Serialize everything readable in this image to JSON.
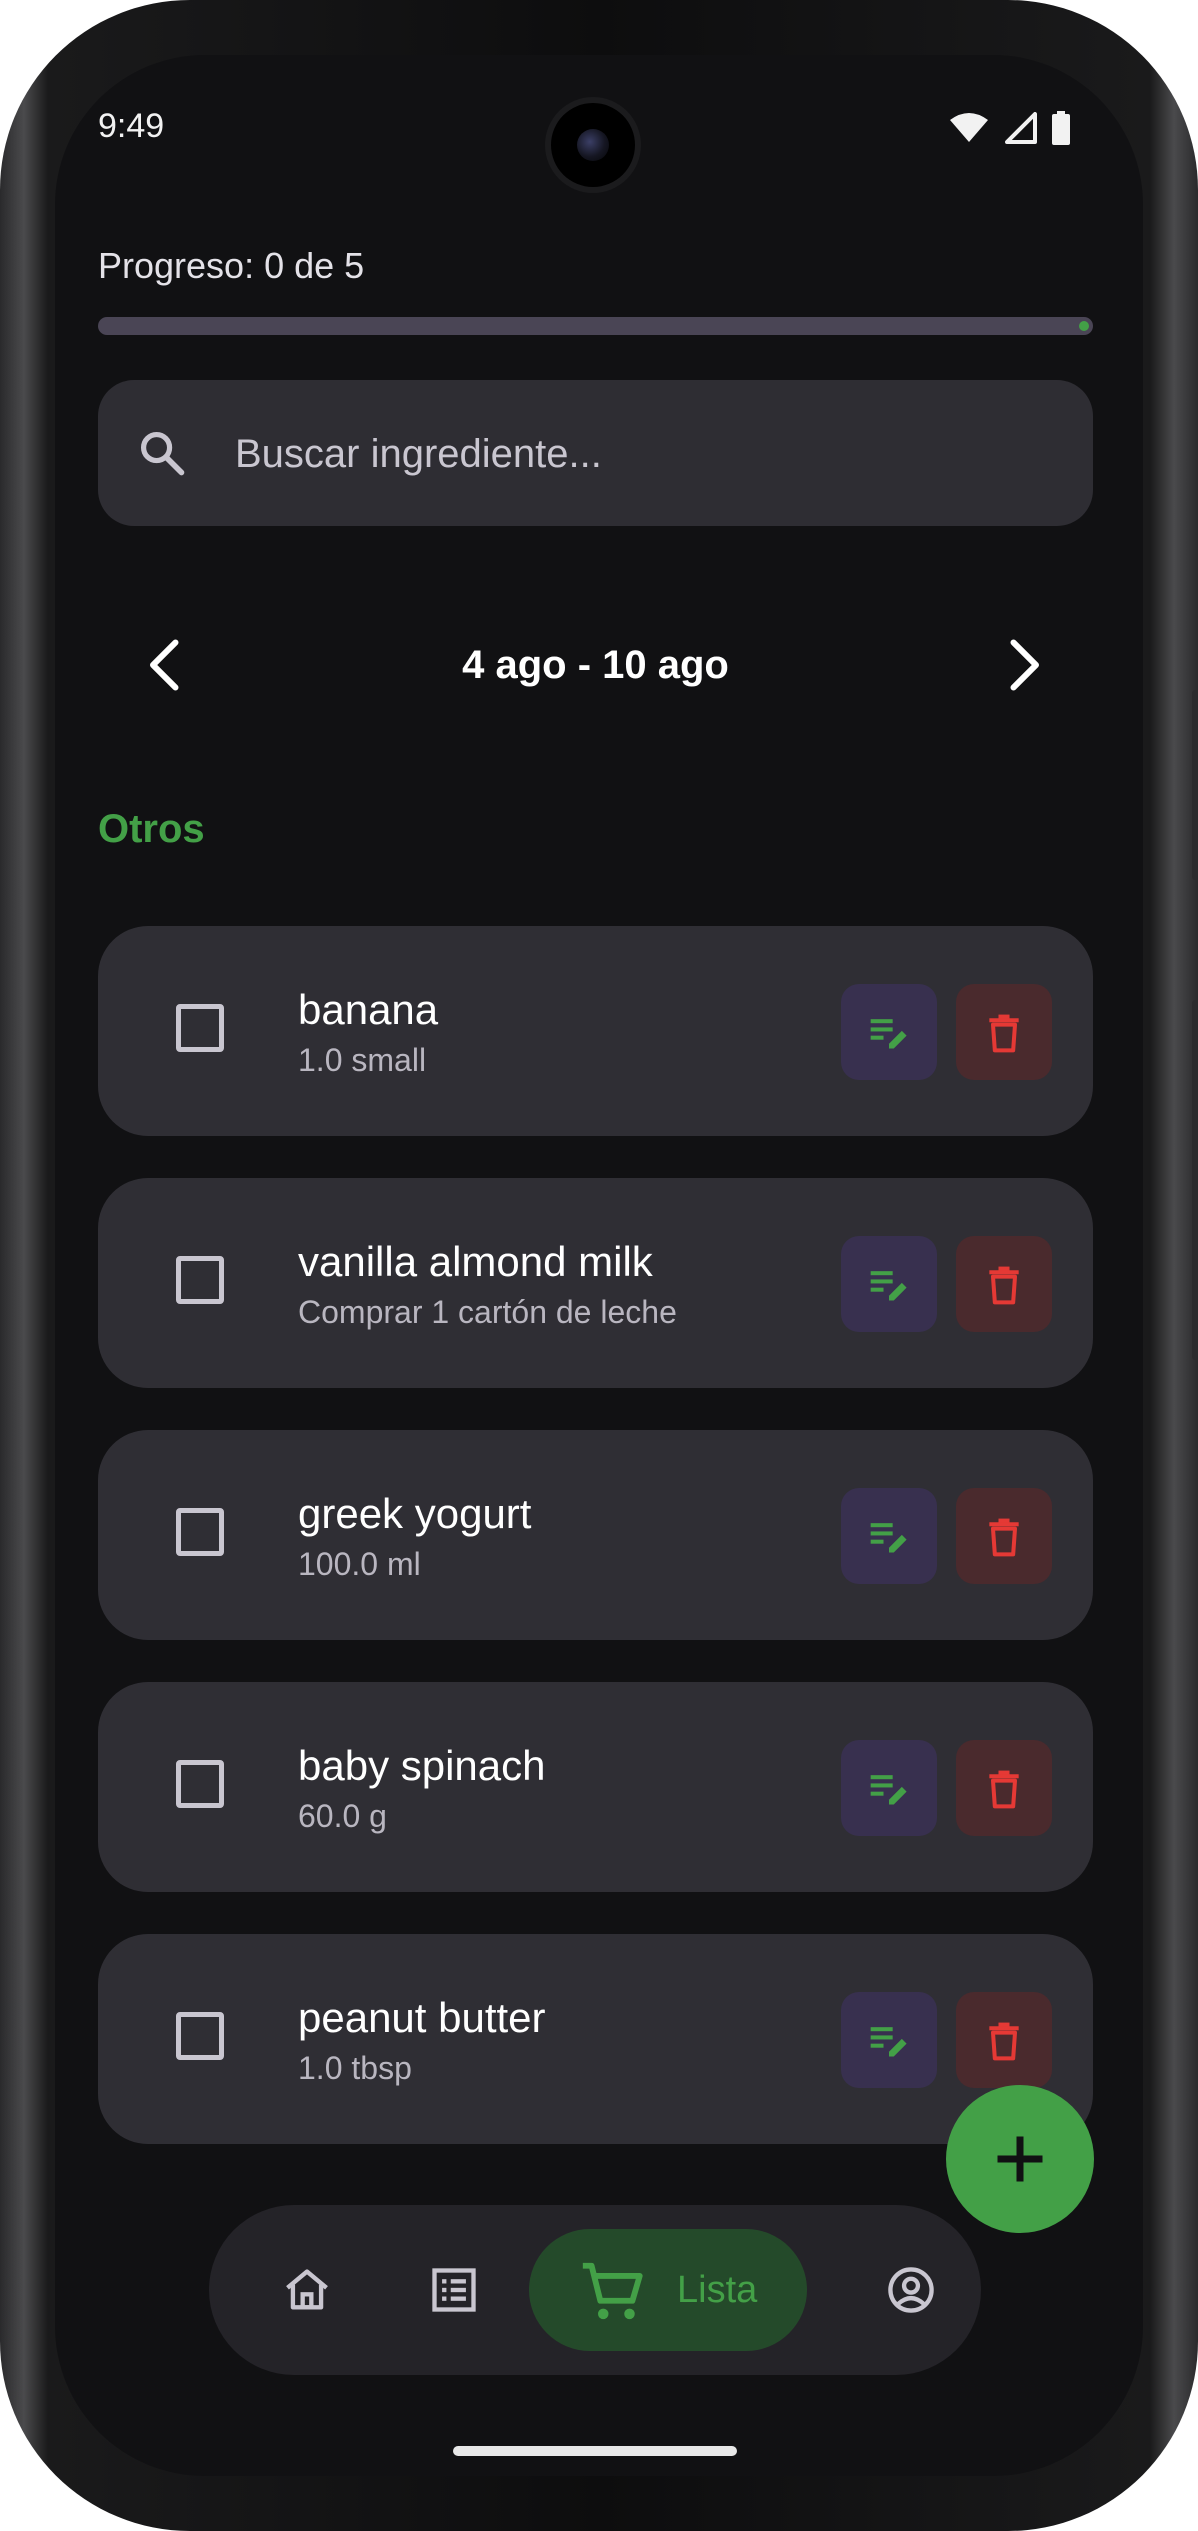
{
  "status_bar": {
    "time": "9:49"
  },
  "progress": {
    "label": "Progreso: 0 de 5",
    "completed": 0,
    "total": 5,
    "fraction": 0
  },
  "search": {
    "placeholder": "Buscar ingrediente...",
    "value": ""
  },
  "week_nav": {
    "range_label": "4 ago - 10 ago"
  },
  "section": {
    "title": "Otros"
  },
  "items": [
    {
      "name": "banana",
      "detail": "1.0 small",
      "checked": false
    },
    {
      "name": "vanilla almond milk",
      "detail": "Comprar 1 cartón de leche",
      "checked": false
    },
    {
      "name": "greek yogurt",
      "detail": "100.0 ml",
      "checked": false
    },
    {
      "name": "baby spinach",
      "detail": "60.0 g",
      "checked": false
    },
    {
      "name": "peanut butter",
      "detail": "1.0 tbsp",
      "checked": false
    }
  ],
  "bottom_nav": {
    "items": [
      {
        "icon": "home-icon"
      },
      {
        "icon": "list-icon"
      },
      {
        "icon": "cart-icon",
        "label": "Lista",
        "active": true
      },
      {
        "icon": "profile-icon"
      }
    ]
  },
  "colors": {
    "accent": "#43a047",
    "delete": "#e53935",
    "background": "#111113",
    "card": "#2f2e34"
  }
}
